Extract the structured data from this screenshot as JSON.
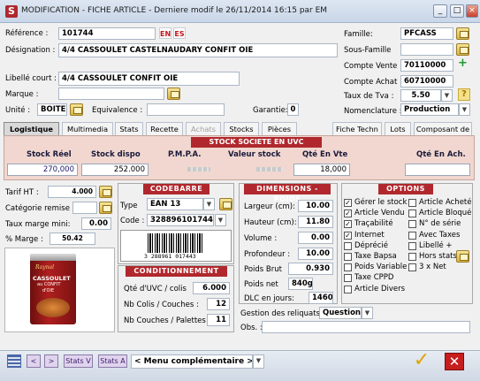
{
  "window": {
    "icon": "S",
    "title": "MODIFICATION - FICHE ARTICLE - Derniere modif le 26/11/2014 16:15 par EM",
    "min": "_",
    "max": "□",
    "close": "×"
  },
  "form": {
    "reference_label": "Référence :",
    "reference": "101744",
    "lang1": "EN",
    "lang2": "ES",
    "designation_label": "Désignation :",
    "designation": "4/4  CASSOULET CASTELNAUDARY CONFIT OIE",
    "libelle_label": "Libellé court :",
    "libelle": "4/4  CASSOULET CONFIT OIE",
    "marque_label": "Marque :",
    "marque": "",
    "unite_label": "Unité :",
    "unite": "BOITE",
    "equivalence_label": "Equivalence :",
    "equivalence": "",
    "garantie_label": "Garantie:",
    "garantie": "0",
    "famille_label": "Famille:",
    "famille": "PFCASS",
    "sousfamille_label": "Sous-Famille",
    "sousfamille": "",
    "compte_vente_label": "Compte Vente :",
    "compte_vente": "70110000",
    "compte_achat_label": "Compte Achat :",
    "compte_achat": "60710000",
    "tva_label": "Taux de Tva :",
    "tva": "5.50",
    "nomenclature_label": "Nomenclature :",
    "nomenclature": "Production"
  },
  "tabs": [
    "Logistique",
    "Multimedia",
    "Stats",
    "Recette",
    "Achats",
    "Stocks",
    "Pièces",
    "Fiche Techn",
    "Lots",
    "Composant de"
  ],
  "stock": {
    "header": "STOCK SOCIETE EN UVC",
    "cols": [
      "Stock Réel",
      "Stock dispo",
      "P.M.P.A.",
      "Valeur stock",
      "Qté En Vte",
      "Qté En Ach."
    ],
    "stock_reel": "270,000",
    "stock_dispo": "252.000",
    "qte_vte": "18,000"
  },
  "left": {
    "tarif_label": "Tarif HT :",
    "tarif": "4.000",
    "cat_label": "Catégorie remise :",
    "taux_label": "Taux marge mini:",
    "taux": "0.00",
    "marge_label": "% Marge :",
    "marge": "50.42"
  },
  "product_image": {
    "brand": "Raynal",
    "line1": "CASSOULET",
    "line2": "au CONFIT",
    "line3": "d'OIE"
  },
  "codebarre": {
    "header": "CODEBARRE",
    "type_label": "Type",
    "type": "EAN 13",
    "code_label": "Code :",
    "code": "3288961017443",
    "barcode_text": "3 288961 017443"
  },
  "condition": {
    "header": "CONDITIONNEMENT",
    "uvc_label": "Qté d'UVC / colis",
    "uvc": "6.000",
    "colis_label": "Nb Colis / Couches :",
    "colis": "12",
    "couches_label": "Nb Couches / Palettes :",
    "couches": "11"
  },
  "dims": {
    "header": "DIMENSIONS - POIDS",
    "largeur_label": "Largeur (cm):",
    "largeur": "10.00",
    "hauteur_label": "Hauteur (cm):",
    "hauteur": "11.80",
    "volume_label": "Volume :",
    "volume": "0.00",
    "profondeur_label": "Profondeur :",
    "profondeur": "10.00",
    "brut_label": "Poids Brut",
    "brut": "0.930",
    "net_label": "Poids net",
    "net": "840g",
    "dlc_label": "DLC en jours:",
    "dlc": "1460"
  },
  "options": {
    "header": "OPTIONS",
    "left": [
      {
        "label": "Gérer le stock",
        "checked": true
      },
      {
        "label": "Article Vendu",
        "checked": true
      },
      {
        "label": "Traçabilité",
        "checked": true
      },
      {
        "label": "Internet",
        "checked": true
      },
      {
        "label": "Déprécié",
        "checked": false
      },
      {
        "label": "Taxe Bapsa",
        "checked": false
      },
      {
        "label": "Poids Variable",
        "checked": false
      },
      {
        "label": "Taxe CPPD",
        "checked": false
      },
      {
        "label": "Article Divers",
        "checked": false
      }
    ],
    "right": [
      {
        "label": "Article Acheté",
        "checked": false
      },
      {
        "label": "Article Bloqué",
        "checked": false
      },
      {
        "label": "N° de série",
        "checked": false
      },
      {
        "label": "Avec Taxes",
        "checked": false
      },
      {
        "label": "Libellé +",
        "checked": false
      },
      {
        "label": "Hors stats",
        "checked": false
      },
      {
        "label": "3 x Net",
        "checked": false
      }
    ]
  },
  "reliquats": {
    "label": "Gestion des reliquats :",
    "value": "Question",
    "obs_label": "Obs. :"
  },
  "footer": {
    "prev": "<",
    "next": ">",
    "statsv": "Stats V",
    "statsa": "Stats A",
    "menu": "< Menu complémentaire >"
  },
  "colors": {
    "accent": "#b0282d",
    "stock_bg": "#f1d7d0"
  }
}
